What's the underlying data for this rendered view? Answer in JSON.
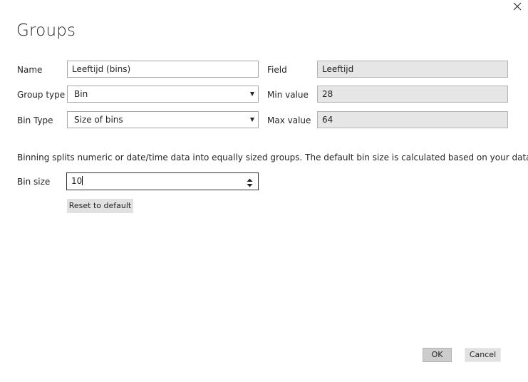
{
  "dialog": {
    "title": "Groups"
  },
  "form": {
    "name_label": "Name",
    "name_value": "Leeftijd (bins)",
    "group_type_label": "Group type",
    "group_type_value": "Bin",
    "bin_type_label": "Bin Type",
    "bin_type_value": "Size of bins",
    "field_label": "Field",
    "field_value": "Leeftijd",
    "min_value_label": "Min value",
    "min_value": "28",
    "max_value_label": "Max value",
    "max_value": "64"
  },
  "binning": {
    "description": "Binning splits numeric or date/time data into equally sized groups. The default bin size is calculated based on your data.",
    "bin_size_label": "Bin size",
    "bin_size_value": "10",
    "reset_label": "Reset to default"
  },
  "footer": {
    "ok_label": "OK",
    "cancel_label": "Cancel"
  },
  "icons": {
    "close": "close-icon",
    "dropdown": "chevron-down-icon",
    "spinner": "spin-arrows-icon"
  }
}
